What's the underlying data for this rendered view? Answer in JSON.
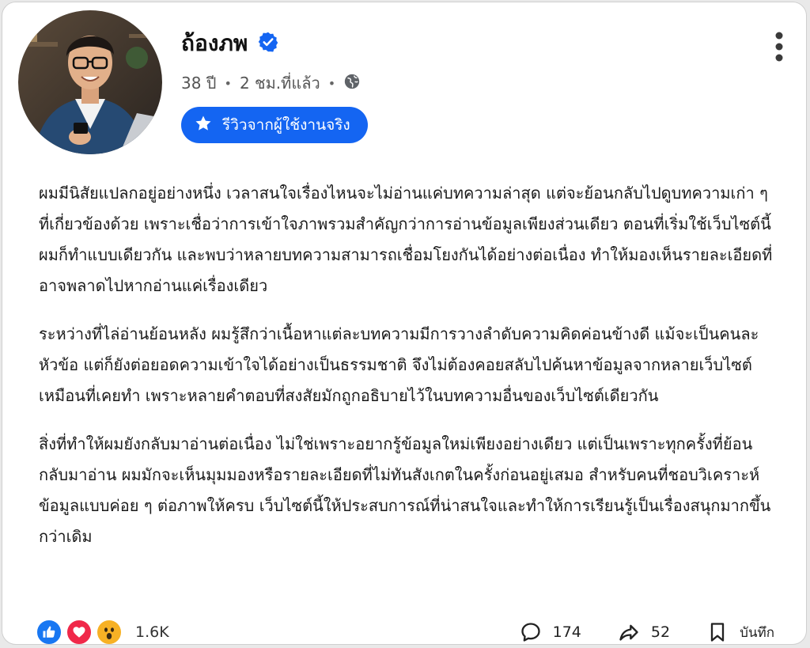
{
  "post": {
    "author": "ถ้องภพ",
    "age": "38 ปี",
    "time": "2 ชม.ที่แล้ว",
    "badge": "รีวิวจากผู้ใช้งานจริง",
    "paragraphs": [
      "ผมมีนิสัยแปลกอยู่อย่างหนึ่ง เวลาสนใจเรื่องไหนจะไม่อ่านแค่บทความล่าสุด แต่จะย้อนกลับไปดูบทความเก่า ๆ ที่เกี่ยวข้องด้วย เพราะเชื่อว่าการเข้าใจภาพรวมสำคัญกว่าการอ่านข้อมูลเพียงส่วนเดียว ตอนที่เริ่มใช้เว็บไซต์นี้ ผมก็ทำแบบเดียวกัน และพบว่าหลายบทความสามารถเชื่อมโยงกันได้อย่างต่อเนื่อง ทำให้มองเห็นรายละเอียดที่อาจพลาดไปหากอ่านแค่เรื่องเดียว",
      "ระหว่างที่ไล่อ่านย้อนหลัง ผมรู้สึกว่าเนื้อหาแต่ละบทความมีการวางลำดับความคิดค่อนข้างดี แม้จะเป็นคนละหัวข้อ แต่ก็ยังต่อยอดความเข้าใจได้อย่างเป็นธรรมชาติ จึงไม่ต้องคอยสลับไปค้นหาข้อมูลจากหลายเว็บไซต์เหมือนที่เคยทำ เพราะหลายคำตอบที่สงสัยมักถูกอธิบายไว้ในบทความอื่นของเว็บไซต์เดียวกัน",
      "สิ่งที่ทำให้ผมยังกลับมาอ่านต่อเนื่อง ไม่ใช่เพราะอยากรู้ข้อมูลใหม่เพียงอย่างเดียว แต่เป็นเพราะทุกครั้งที่ย้อนกลับมาอ่าน ผมมักจะเห็นมุมมองหรือรายละเอียดที่ไม่ทันสังเกตในครั้งก่อนอยู่เสมอ สำหรับคนที่ชอบวิเคราะห์ข้อมูลแบบค่อย ๆ ต่อภาพให้ครบ เว็บไซต์นี้ให้ประสบการณ์ที่น่าสนใจและทำให้การเรียนรู้เป็นเรื่องสนุกมากขึ้นกว่าเดิม"
    ]
  },
  "footer": {
    "reaction_count": "1.6K",
    "comments": "174",
    "shares": "52",
    "save_label": "บันทึก"
  },
  "colors": {
    "accent": "#1465f2",
    "like": "#1877f2",
    "love": "#f02849",
    "wow": "#f7b125"
  },
  "icons": [
    "verified-icon",
    "globe-icon",
    "star-icon",
    "more-icon",
    "like-icon",
    "love-icon",
    "wow-icon",
    "comment-icon",
    "share-icon",
    "bookmark-icon"
  ]
}
